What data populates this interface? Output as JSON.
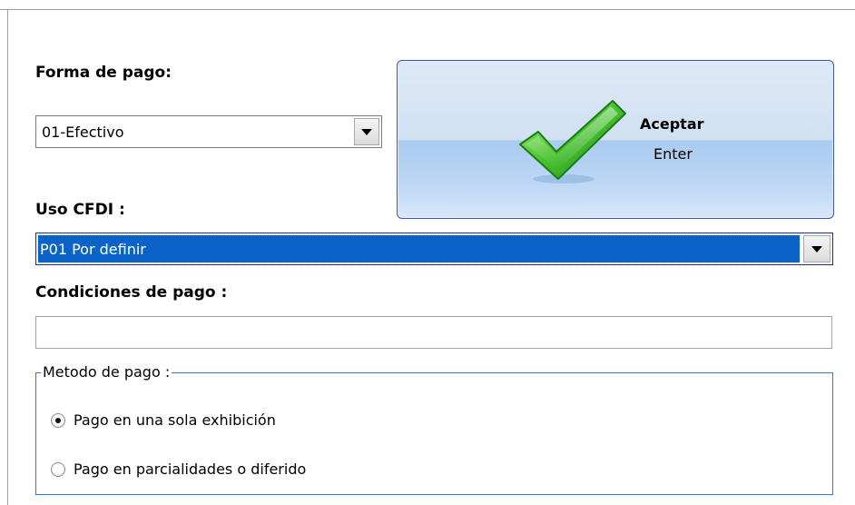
{
  "form": {
    "forma_pago": {
      "label": "Forma de pago:",
      "selected": "01-Efectivo"
    },
    "uso_cfdi": {
      "label": "Uso CFDI :",
      "selected": "P01 Por definir"
    },
    "condiciones": {
      "label": "Condiciones de pago :",
      "value": ""
    },
    "metodo": {
      "legend": "Metodo de pago :",
      "options": [
        {
          "label": "Pago en una sola exhibición",
          "checked": true
        },
        {
          "label": "Pago en parcialidades o diferido",
          "checked": false
        }
      ]
    }
  },
  "accept_button": {
    "title": "Aceptar",
    "shortcut": "Enter",
    "icon": "checkmark-icon"
  },
  "colors": {
    "focus_highlight": "#0a63c9",
    "group_border": "#2c7ad6",
    "button_border": "#3b56b6",
    "check_green": "#3db52a"
  }
}
